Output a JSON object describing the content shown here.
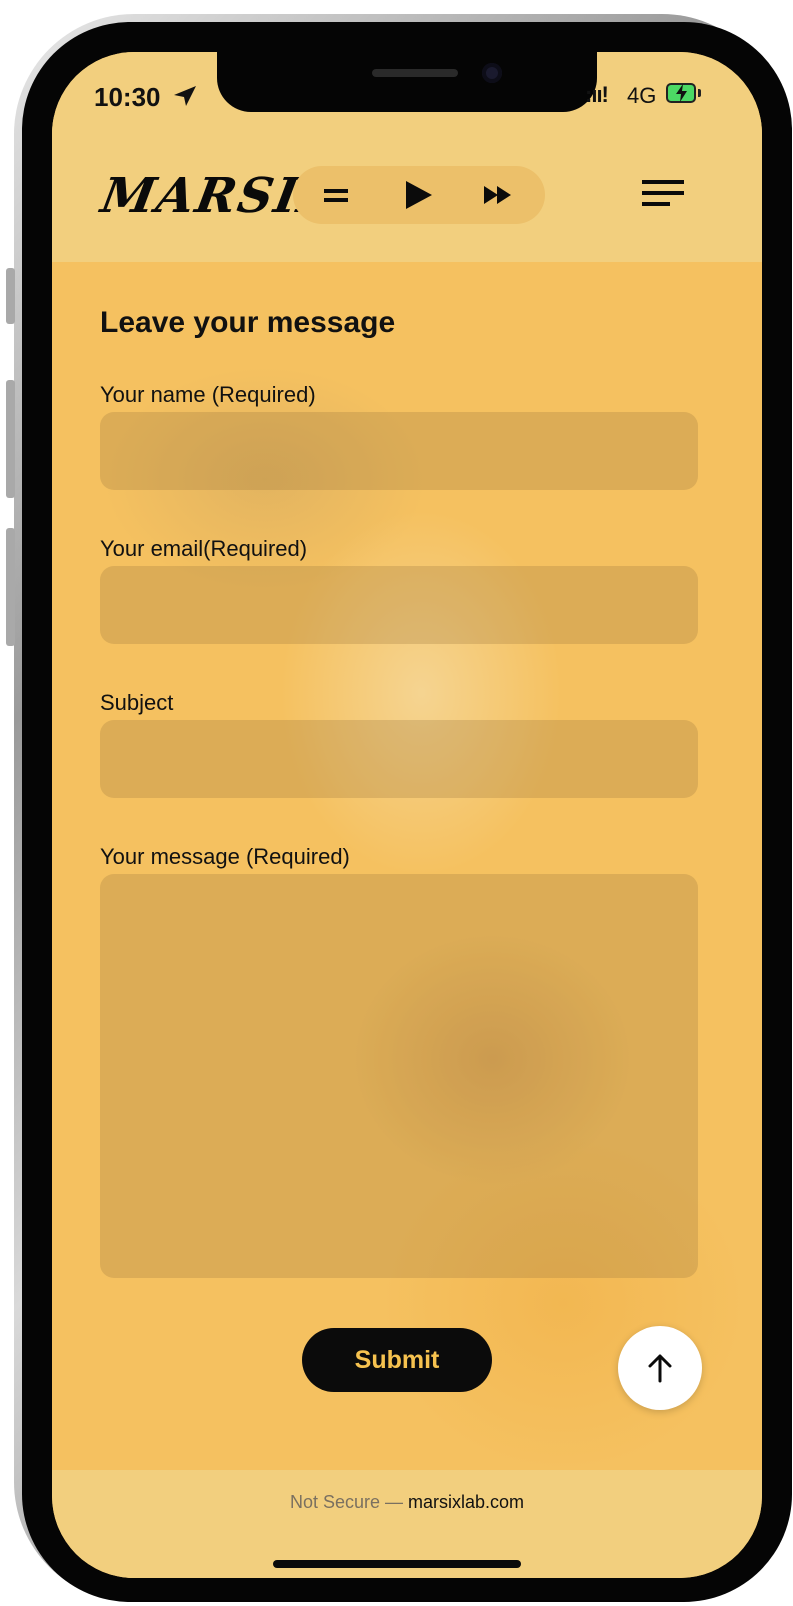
{
  "status_bar": {
    "time": "10:30",
    "signal_text": ":ıı!",
    "network": "4G",
    "icons": [
      "location-arrow-icon",
      "signal-icon",
      "battery-charging-icon"
    ]
  },
  "header": {
    "logo": "MARSIX",
    "player_icons": [
      "playlist-icon",
      "play-icon",
      "fast-forward-icon"
    ],
    "menu_icon": "hamburger-menu-icon"
  },
  "form": {
    "title": "Leave your message",
    "fields": [
      {
        "label": "Your name (Required)",
        "value": ""
      },
      {
        "label": "Your email(Required)",
        "value": ""
      },
      {
        "label": "Subject",
        "value": ""
      },
      {
        "label": "Your message (Required)",
        "value": ""
      }
    ],
    "submit_label": "Submit"
  },
  "scroll_top_icon": "arrow-up-icon",
  "browser": {
    "security": "Not Secure",
    "separator": " — ",
    "domain": "marsixlab.com"
  },
  "colors": {
    "accent": "#f6c24f",
    "background": "#f5c160",
    "bar": "#f2cf7e",
    "dark": "#0b0b0b"
  }
}
